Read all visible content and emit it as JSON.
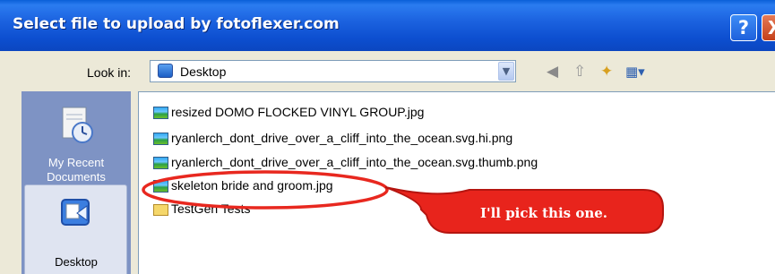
{
  "window": {
    "title": "Select file to upload by fotoflexer.com"
  },
  "titlebar_buttons": {
    "help": "?",
    "close": "X"
  },
  "lookin": {
    "label": "Look in:",
    "value": "Desktop",
    "icon": "desktop-icon"
  },
  "toolbar": [
    {
      "name": "back-icon",
      "glyph": "◀"
    },
    {
      "name": "up-folder-icon",
      "glyph": "⇧"
    },
    {
      "name": "new-folder-icon",
      "glyph": "✦"
    },
    {
      "name": "views-menu-icon",
      "glyph": "▦▾"
    }
  ],
  "places": [
    {
      "label_line1": "My Recent",
      "label_line2": "Documents",
      "icon": "my-recent-documents-icon"
    },
    {
      "label_line1": "Desktop",
      "label_line2": "",
      "icon": "desktop-icon"
    }
  ],
  "files": [
    {
      "name": "resized DOMO FLOCKED VINYL GROUP.jpg",
      "type": "image"
    },
    {
      "name": "ryanlerch_dont_drive_over_a_cliff_into_the_ocean.svg.hi.png",
      "type": "image"
    },
    {
      "name": "ryanlerch_dont_drive_over_a_cliff_into_the_ocean.svg.thumb.png",
      "type": "image"
    },
    {
      "name": "skeleton bride and groom.jpg",
      "type": "image"
    },
    {
      "name": "TestGen Tests",
      "type": "folder"
    }
  ],
  "annotation": {
    "callout_text": "I'll pick this one.",
    "highlight_color": "#e8281f",
    "callout_color": "#e8241c"
  }
}
